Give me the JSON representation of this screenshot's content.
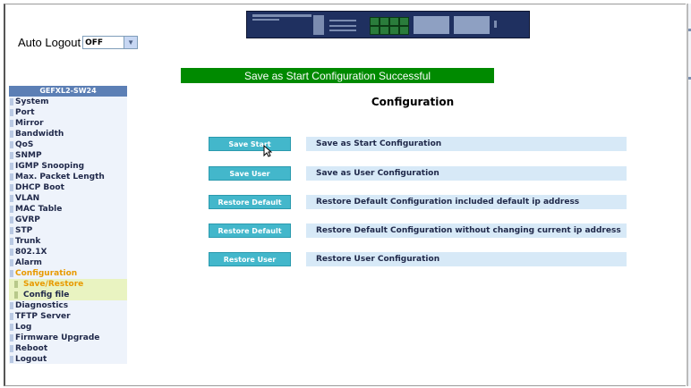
{
  "auto_logout": {
    "label": "Auto Logout",
    "selected": "OFF"
  },
  "banner": "Save as Start Configuration Successful",
  "page_title": "Configuration",
  "sidebar": {
    "header": "GEFXL2-SW24",
    "items": [
      {
        "label": "System"
      },
      {
        "label": "Port"
      },
      {
        "label": "Mirror"
      },
      {
        "label": "Bandwidth"
      },
      {
        "label": "QoS"
      },
      {
        "label": "SNMP"
      },
      {
        "label": "IGMP Snooping"
      },
      {
        "label": "Max. Packet Length"
      },
      {
        "label": "DHCP Boot"
      },
      {
        "label": "VLAN"
      },
      {
        "label": "MAC Table"
      },
      {
        "label": "GVRP"
      },
      {
        "label": "STP"
      },
      {
        "label": "Trunk"
      },
      {
        "label": "802.1X"
      },
      {
        "label": "Alarm"
      },
      {
        "label": "Configuration"
      },
      {
        "label": "Save/Restore"
      },
      {
        "label": "Config file"
      },
      {
        "label": "Diagnostics"
      },
      {
        "label": "TFTP Server"
      },
      {
        "label": "Log"
      },
      {
        "label": "Firmware Upgrade"
      },
      {
        "label": "Reboot"
      },
      {
        "label": "Logout"
      }
    ]
  },
  "actions": [
    {
      "button": "Save Start",
      "description": "Save as Start Configuration"
    },
    {
      "button": "Save User",
      "description": "Save as User Configuration"
    },
    {
      "button": "Restore Default",
      "description": "Restore Default Configuration included default ip address"
    },
    {
      "button": "Restore Default",
      "description": "Restore Default Configuration without changing current ip address"
    },
    {
      "button": "Restore User",
      "description": "Restore User Configuration"
    }
  ],
  "icons": [
    "switch-panel-icon",
    "chevron-down-icon",
    "cursor-icon"
  ],
  "colors": {
    "banner": "#008a00",
    "button": "#43b7cb",
    "sidebar_header": "#5c7fb5",
    "active_item": "#e89a00"
  }
}
